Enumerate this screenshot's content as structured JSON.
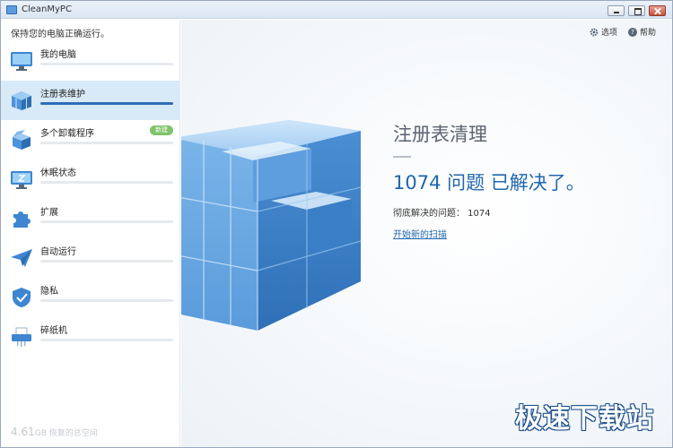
{
  "window": {
    "title": "CleanMyPC"
  },
  "sidebar": {
    "tagline": "保持您的电脑正确运行。",
    "items": [
      {
        "label": "我的电脑",
        "icon": "monitor-icon"
      },
      {
        "label": "注册表维护",
        "icon": "registry-cube-icon",
        "active": true
      },
      {
        "label": "多个卸载程序",
        "icon": "uninstaller-box-icon",
        "badge": "新建"
      },
      {
        "label": "休眠状态",
        "icon": "hibernate-monitor-icon"
      },
      {
        "label": "扩展",
        "icon": "puzzle-icon"
      },
      {
        "label": "自动运行",
        "icon": "paper-plane-icon"
      },
      {
        "label": "隐私",
        "icon": "shield-icon"
      },
      {
        "label": "碎纸机",
        "icon": "shredder-icon"
      }
    ],
    "footer": {
      "amount": "4.61",
      "unit": "GB",
      "text": "恢复的总空间"
    }
  },
  "header": {
    "options_label": "选项",
    "help_label": "帮助"
  },
  "main": {
    "title": "注册表清理",
    "result": "1074 问题 已解决了。",
    "detail": "彻底解决的问题： 1074",
    "rescan_link": "开始新的扫描"
  },
  "watermark": "极速下载站",
  "colors": {
    "accent": "#1f66ad",
    "active_bg": "#d8e9f8",
    "badge": "#7fc36a"
  }
}
